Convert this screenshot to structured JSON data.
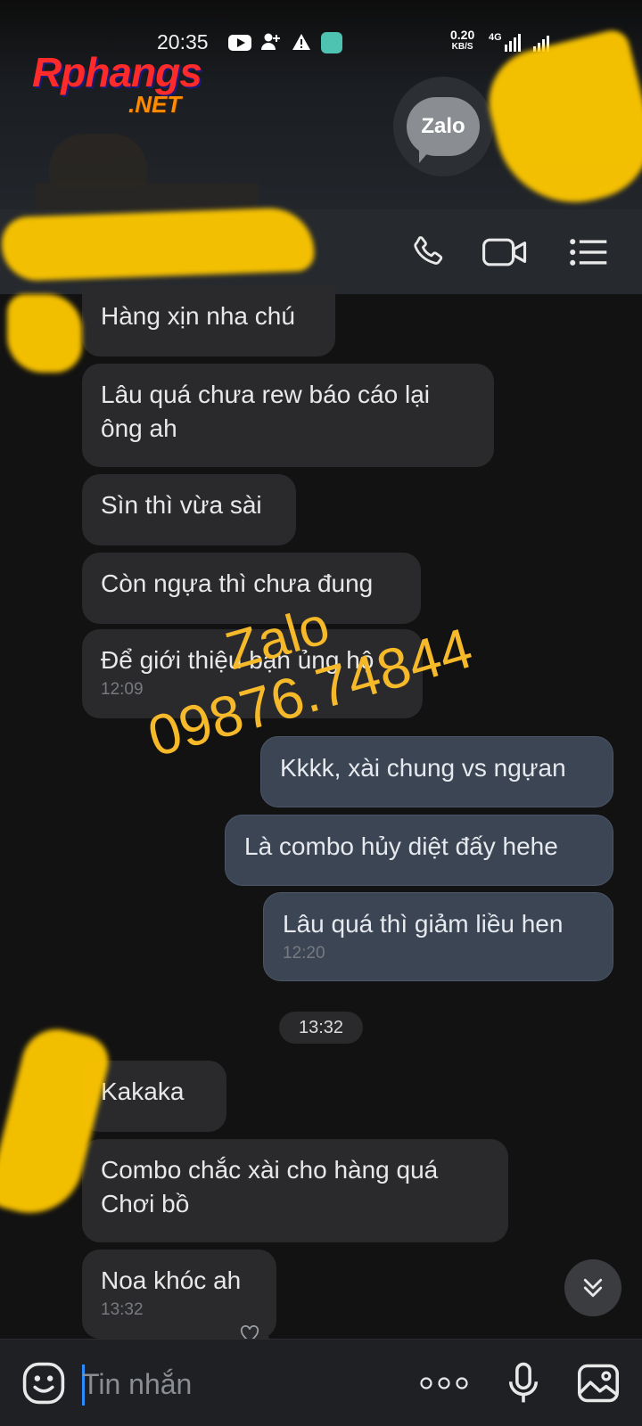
{
  "status_bar": {
    "time": "20:35",
    "net_speed_value": "0.20",
    "net_speed_unit": "KB/S",
    "network_type": "4G"
  },
  "watermark_logo": {
    "main": "Rphangs",
    "suffix": ".NET"
  },
  "zalo_badge": {
    "label": "Zalo"
  },
  "overlay_watermark": {
    "line1": "Zalo",
    "line2": "09876.74844"
  },
  "messages": [
    {
      "side": "in",
      "text": "Hàng xịn nha chú"
    },
    {
      "side": "in",
      "text": "Lâu quá chưa rew báo cáo lại ông ah"
    },
    {
      "side": "in",
      "text": "Sìn thì vừa sài"
    },
    {
      "side": "in",
      "text": "Còn ngựa thì chưa đung"
    },
    {
      "side": "in",
      "text": "Để giới thiệu bạn ủng hộ",
      "time": "12:09"
    },
    {
      "side": "out",
      "text": "Kkkk, xài chung vs ngựan"
    },
    {
      "side": "out",
      "text": "Là combo hủy diệt đấy hehe"
    },
    {
      "side": "out",
      "text": "Lâu quá thì giảm liều hen",
      "time": "12:20"
    },
    {
      "side": "in",
      "text": "Kakaka"
    },
    {
      "side": "in",
      "text": "Combo chắc xài cho hàng quá Chơi bồ"
    },
    {
      "side": "in",
      "text": "Noa khóc ah",
      "time": "13:32"
    }
  ],
  "time_separator": "13:32",
  "input_bar": {
    "placeholder": "Tin nhắn"
  },
  "colors": {
    "background": "#121212",
    "incoming_bubble": "#2a2a2c",
    "outgoing_bubble": "#3b4553",
    "caret": "#2b8cff",
    "watermark": "#f6b92a",
    "censor": "#ffc800"
  },
  "icons": [
    "youtube-icon",
    "add-user-icon",
    "warning-icon",
    "app-icon",
    "signal-icon",
    "zalo-icon",
    "phone-icon",
    "video-call-icon",
    "menu-icon",
    "scroll-down-icon",
    "heart-icon",
    "emoji-icon",
    "more-icon",
    "microphone-icon",
    "image-icon"
  ]
}
